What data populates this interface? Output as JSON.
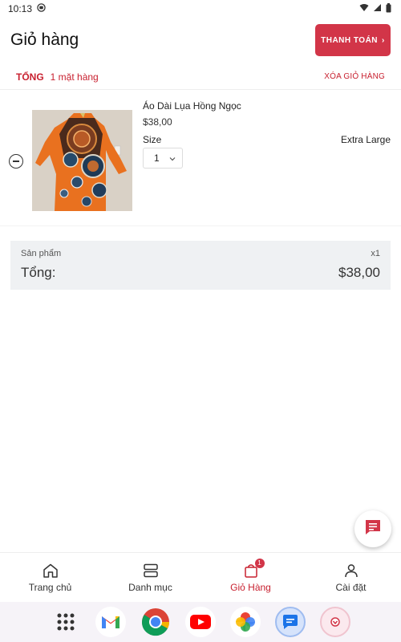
{
  "status_bar": {
    "time": "10:13"
  },
  "header": {
    "title": "Giỏ hàng",
    "checkout_label": "THANH TOÁN",
    "checkout_chevron": "›"
  },
  "summary": {
    "total_label": "TỔNG",
    "item_count": "1 mặt hàng",
    "clear_cart": "XÓA GIỎ HÀNG"
  },
  "cart_items": [
    {
      "name": "Áo Dài Lụa Hồng Ngọc",
      "price": "$38,00",
      "size_label": "Size",
      "size_value": "Extra Large",
      "quantity": "1"
    }
  ],
  "totals": {
    "products_label": "Sản phẩm",
    "products_count": "x1",
    "total_label": "Tổng:",
    "total_value": "$38,00"
  },
  "bottom_nav": [
    {
      "label": "Trang chủ",
      "icon": "home-icon",
      "active": false
    },
    {
      "label": "Danh mục",
      "icon": "category-icon",
      "active": false
    },
    {
      "label": "Giỏ Hàng",
      "icon": "bag-icon",
      "active": true,
      "badge": "1"
    },
    {
      "label": "Cài đặt",
      "icon": "person-icon",
      "active": false
    }
  ],
  "dock_apps": [
    "apps-grid-icon",
    "gmail-icon",
    "chrome-icon",
    "youtube-icon",
    "photos-icon",
    "messages-icon",
    "app-icon"
  ],
  "colors": {
    "accent": "#d23548",
    "accent_text": "#c8202f",
    "totals_bg": "#eff1f3"
  }
}
